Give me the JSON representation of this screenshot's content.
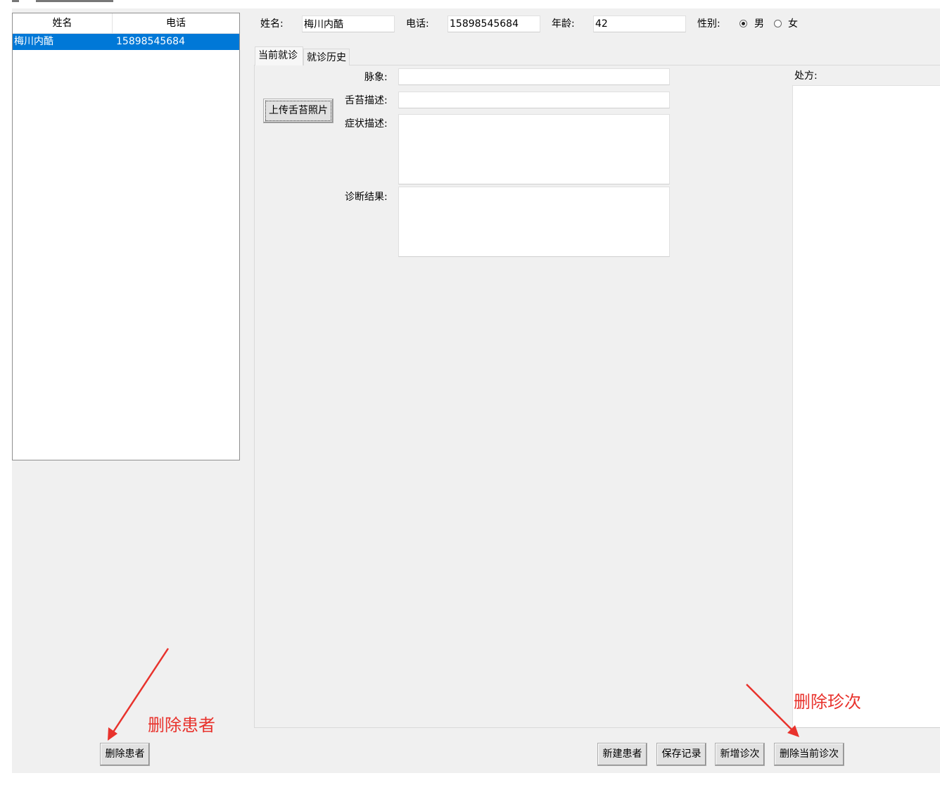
{
  "patient_list": {
    "columns": [
      "姓名",
      "电话"
    ],
    "rows": [
      {
        "name": "梅川内酷",
        "phone": "15898545684",
        "selected": true
      }
    ]
  },
  "patient_form": {
    "name_label": "姓名:",
    "name_value": "梅川内酷",
    "phone_label": "电话:",
    "phone_value": "15898545684",
    "age_label": "年龄:",
    "age_value": "42",
    "gender_label": "性别:",
    "gender_options": [
      "男",
      "女"
    ],
    "gender_selected": "男"
  },
  "tabs": [
    {
      "label": "当前就诊",
      "active": true
    },
    {
      "label": "就诊历史",
      "active": false
    }
  ],
  "visit": {
    "upload_button": "上传舌苔照片",
    "pulse_label": "脉象:",
    "tongue_label": "舌苔描述:",
    "symptom_label": "症状描述:",
    "diagnosis_label": "诊断结果:",
    "prescription_label": "处方:",
    "pulse_value": "",
    "tongue_value": "",
    "symptom_value": "",
    "diagnosis_value": "",
    "prescription_value": ""
  },
  "buttons": {
    "delete_patient": "删除患者",
    "new_patient": "新建患者",
    "save_record": "保存记录",
    "add_visit": "新增诊次",
    "delete_visit": "删除当前诊次"
  },
  "annotations": {
    "delete_patient_note": "删除患者",
    "delete_visit_note": "删除珍次",
    "color": "#e8322c"
  },
  "colors": {
    "selection": "#0078d7",
    "window_bg": "#f0f0f0"
  }
}
